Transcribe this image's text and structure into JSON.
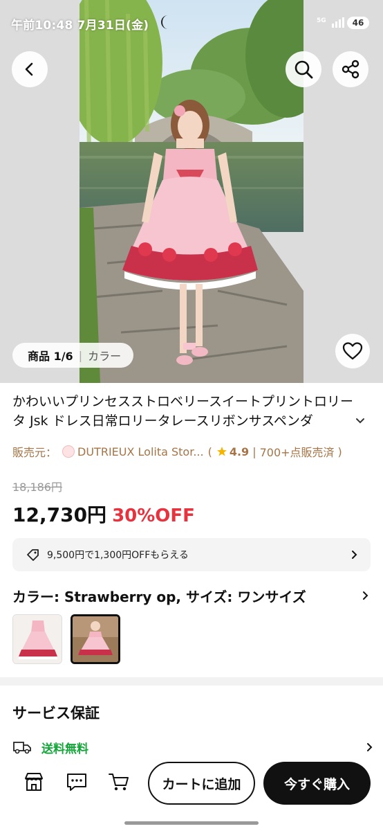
{
  "status_bar": {
    "time": "午前10:48  7月31日(金)",
    "network": "5G",
    "battery": "46"
  },
  "gallery": {
    "counter": "商品 1/6",
    "separator": "|",
    "tab": "カラー"
  },
  "product": {
    "title": "かわいいプリンセスストロベリースイートプリントロリータ Jsk ドレス日常ロリータレースリボンサスペンダ",
    "seller_prefix": "販売元：",
    "seller_name": "DUTRIEUX Lolita Stor...",
    "rating_open": "(",
    "rating": "4.9",
    "rating_sep": "|",
    "sold": "700+点販売済",
    "rating_close": ")",
    "original_price": "18,186円",
    "sale_price": "12,730円",
    "discount": "30%OFF"
  },
  "coupon": {
    "text": "9,500円で1,300円OFFもらえる"
  },
  "variant": {
    "label": "カラー: Strawberry op, サイズ: ワンサイズ",
    "options": [
      "Strawberry op (front)",
      "Strawberry op (model)"
    ],
    "selected_index": 1
  },
  "service": {
    "title": "サービス保証",
    "shipping": "送料無料"
  },
  "bottom_bar": {
    "add_to_cart": "カートに追加",
    "buy_now": "今すぐ購入"
  },
  "colors": {
    "accent_red": "#e8323e",
    "seller_brown": "#a67446",
    "shipping_green": "#15a63a",
    "primary_black": "#111111"
  },
  "icons": [
    "back-icon",
    "search-icon",
    "share-icon",
    "heart-icon",
    "tag-icon",
    "chevron-right-icon",
    "truck-icon",
    "store-icon",
    "chat-icon",
    "cart-icon",
    "star-icon",
    "moon-icon"
  ]
}
